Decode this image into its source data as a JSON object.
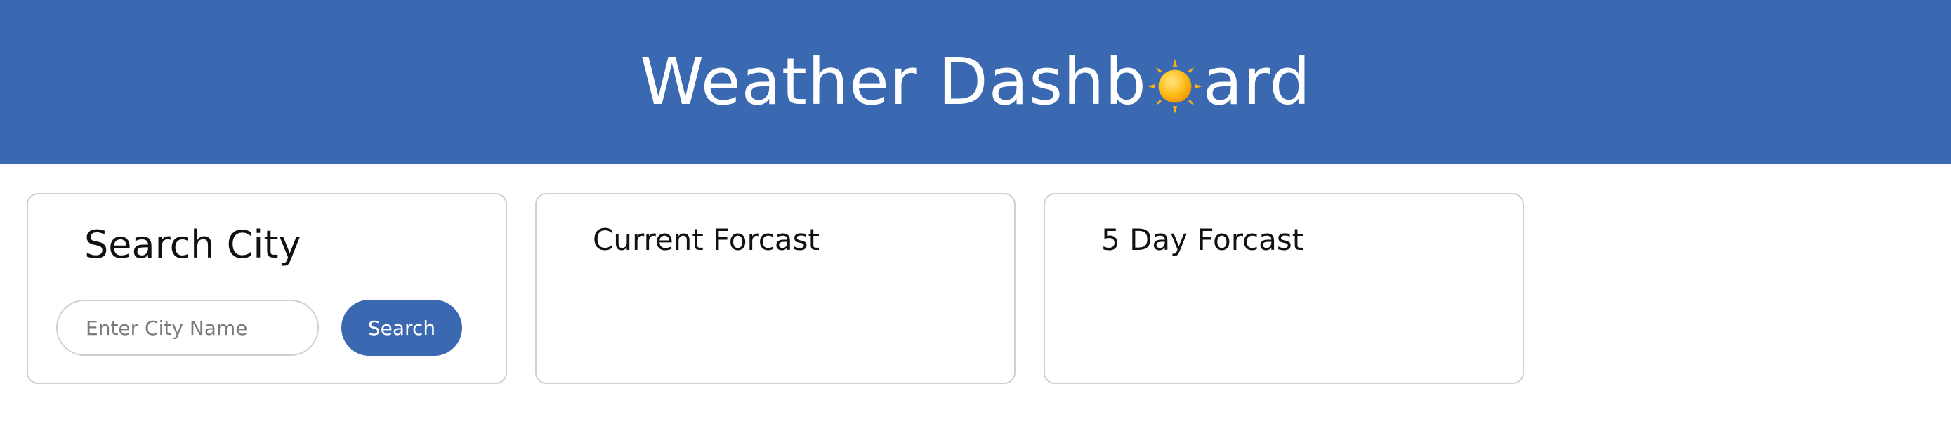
{
  "header": {
    "title_before": "Weather Dashb",
    "title_icon": "sun-icon",
    "title_after": "ard",
    "background_color": "#3a68b1"
  },
  "search_card": {
    "heading": "Search City",
    "input_placeholder": "Enter City Name",
    "input_value": "",
    "button_label": "Search"
  },
  "current_card": {
    "heading": "Current Forcast"
  },
  "five_day_card": {
    "heading": "5 Day Forcast"
  }
}
